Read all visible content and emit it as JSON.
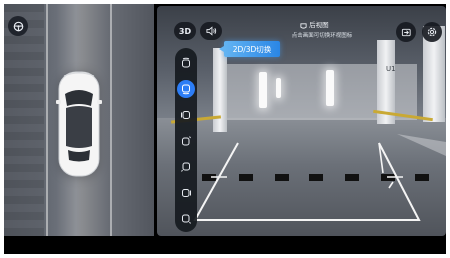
{
  "top_bar": {
    "mode_3d_label": "3D"
  },
  "tooltip": {
    "text": "2D/3D切换"
  },
  "camera_view": {
    "title": "后视图",
    "hint": "点击画面可切换环视图标",
    "pillar_sign": "U1"
  },
  "toolbar": {
    "items": [
      {
        "icon": "front-view-icon",
        "active": false
      },
      {
        "icon": "rear-view-icon",
        "active": true
      },
      {
        "icon": "left-side-view-icon",
        "active": false
      },
      {
        "icon": "right-front-wheel-icon",
        "active": false
      },
      {
        "icon": "left-rear-wheel-icon",
        "active": false
      },
      {
        "icon": "right-side-view-icon",
        "active": false
      },
      {
        "icon": "right-rear-wheel-icon",
        "active": false
      }
    ]
  },
  "colors": {
    "accent": "#2c7df6",
    "guide_lines": "#f4f4f4",
    "button_bg": "#161a20"
  }
}
